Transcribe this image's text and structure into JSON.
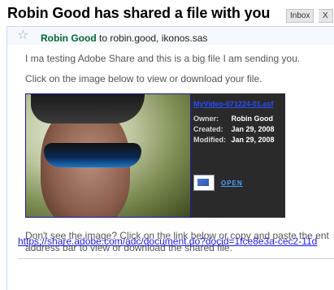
{
  "email": {
    "subject": "Robin Good has shared a file with you",
    "labels": {
      "inbox": "Inbox",
      "remove": "X"
    },
    "sender": "Robin Good",
    "recipients_prefix": " to ",
    "recipients": "robin.good, ikonos.sas",
    "body": {
      "line1": "I ma testing Adobe Share and this is a big file I am sending you.",
      "line2": "Click on the image below to view or download your file.",
      "line3a": "Don't see the image? Click on the link below or copy and paste the ent",
      "line3b": "address bar to view or download the shared file.",
      "url": "https://share.adobe.com/adc/document.do?docid=1fce8e3a-cec2-11d"
    },
    "attachment": {
      "file_name": "MyVideo-071224-01.asf",
      "owner_label": "Owner:",
      "owner": "Robin Good",
      "created_label": "Created:",
      "created": "Jan 29, 2008",
      "modified_label": "Modified:",
      "modified": "Jan 29, 2008",
      "open_label": "OPEN"
    }
  },
  "colors": {
    "sender": "#006633",
    "link": "#1a1ae0",
    "card": "#2a2a2a"
  }
}
